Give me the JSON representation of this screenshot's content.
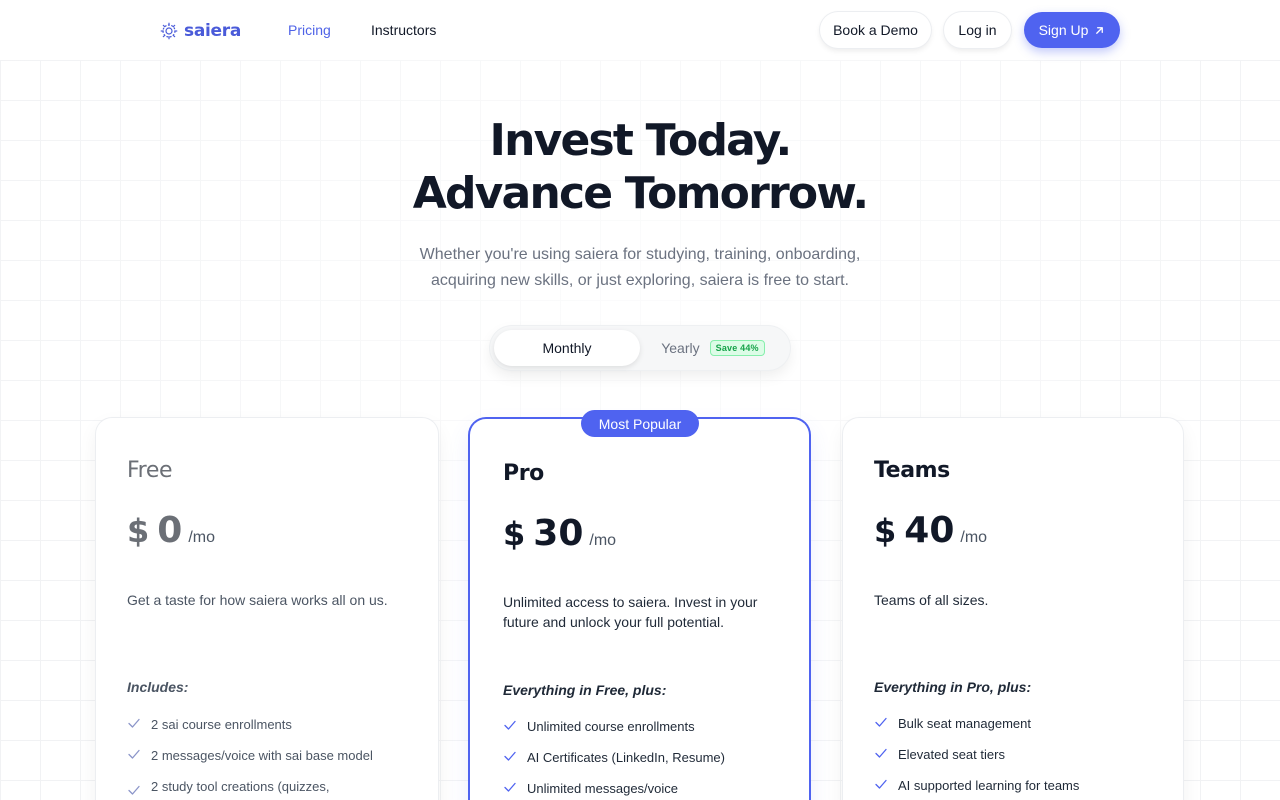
{
  "header": {
    "logo_text": "saiera",
    "nav": [
      {
        "label": "Pricing",
        "active": true
      },
      {
        "label": "Instructors",
        "active": false
      }
    ],
    "book_demo_label": "Book a Demo",
    "login_label": "Log in",
    "signup_label": "Sign Up",
    "accent_color": "#4f63f0"
  },
  "hero": {
    "title_line1": "Invest Today.",
    "title_line2": "Advance Tomorrow.",
    "subtitle_line1": "Whether you're using saiera for studying, training, onboarding,",
    "subtitle_line2": "acquiring new skills, or just exploring, saiera is free to start."
  },
  "billing_toggle": {
    "monthly_label": "Monthly",
    "yearly_label": "Yearly",
    "save_badge": "Save 44%",
    "selected": "Monthly"
  },
  "plans": [
    {
      "name": "Free",
      "currency": "$",
      "price": "0",
      "per": "/mo",
      "description": "Get a taste for how saiera works all on us.",
      "includes_label": "Includes:",
      "features": [
        "2 sai course enrollments",
        "2 messages/voice with sai base model",
        "2 study tool creations (quizzes,"
      ]
    },
    {
      "name": "Pro",
      "badge": "Most Popular",
      "currency": "$",
      "price": "30",
      "per": "/mo",
      "description": "Unlimited access to saiera. Invest in your future and unlock your full potential.",
      "includes_label": "Everything in Free, plus:",
      "features": [
        "Unlimited course enrollments",
        "AI Certificates (LinkedIn, Resume)",
        "Unlimited messages/voice"
      ]
    },
    {
      "name": "Teams",
      "currency": "$",
      "price": "40",
      "per": "/mo",
      "description": "Teams of all sizes.",
      "includes_label": "Everything in Pro, plus:",
      "features": [
        "Bulk seat management",
        "Elevated seat tiers",
        "AI supported learning for teams"
      ]
    }
  ]
}
